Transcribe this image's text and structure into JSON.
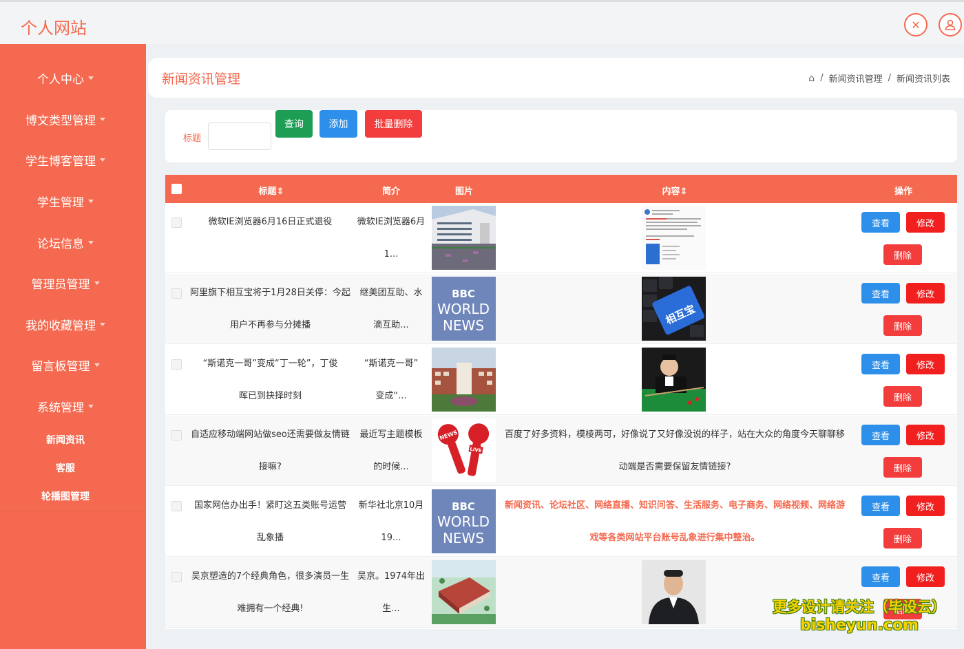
{
  "brand": "个人网站",
  "sidebar": {
    "menus": [
      {
        "label": "个人中心"
      },
      {
        "label": "博文类型管理"
      },
      {
        "label": "学生博客管理"
      },
      {
        "label": "学生管理"
      },
      {
        "label": "论坛信息"
      },
      {
        "label": "管理员管理"
      },
      {
        "label": "我的收藏管理"
      },
      {
        "label": "留言板管理"
      },
      {
        "label": "系统管理"
      }
    ],
    "submenus": [
      {
        "label": "新闻资讯"
      },
      {
        "label": "客服"
      },
      {
        "label": "轮播图管理"
      }
    ]
  },
  "header": {
    "title": "新闻资讯管理",
    "breadcrumb": [
      "新闻资讯管理",
      "新闻资讯列表"
    ]
  },
  "search": {
    "label": "标题",
    "query_button": "查询",
    "add_button": "添加",
    "batch_delete_button": "批量删除"
  },
  "table": {
    "headers": {
      "title": "标题⇕",
      "intro": "简介",
      "image": "图片",
      "content": "内容⇕",
      "actions": "操作"
    },
    "actions": {
      "view": "查看",
      "edit": "修改",
      "delete": "删除"
    },
    "rows": [
      {
        "title1": "微软IE浏览器6月16日正式退役",
        "title2": "",
        "intro1": "微软IE浏览器6月",
        "intro2": "1...",
        "image": "campus",
        "content_image": "document",
        "content1": "",
        "content2": ""
      },
      {
        "title1": "阿里旗下相互宝将于1月28日关停：今起",
        "title2": "用户不再参与分摊播",
        "intro1": "继美团互助、水",
        "intro2": "滴互助...",
        "image": "bbc",
        "content_image": "keyboard",
        "content1": "",
        "content2": ""
      },
      {
        "title1": "“斯诺克一哥”变成“丁一轮”，丁俊",
        "title2": "晖已到抉择时刻",
        "intro1": "“斯诺克一哥”",
        "intro2": "变成“...",
        "image": "building",
        "content_image": "snooker",
        "content1": "",
        "content2": ""
      },
      {
        "title1": "自适应移动端网站做seo还需要做友情链",
        "title2": "接嘛?",
        "intro1": "最近写主题模板",
        "intro2": "的时候...",
        "image": "mic",
        "content_image": "",
        "content1": "百度了好多资料，模棱两可，好像说了又好像没说的样子，站在大众的角度今天聊聊移",
        "content2": "动端是否需要保留友情链接?"
      },
      {
        "title1": "国家网信办出手！紧盯这五类账号运营",
        "title2": "乱象播",
        "intro1": "新华社北京10月",
        "intro2": "19...",
        "image": "bbc",
        "content_image": "",
        "content1": "新闻资讯、论坛社区、网络直播、知识问答、生活服务、电子商务、网络视频、网络游",
        "content2": "戏等各类网站平台账号乱象进行集中整治。"
      },
      {
        "title1": "吴京塑造的7个经典角色，很多演员一生",
        "title2": "难拥有一个经典!",
        "intro1": "吴京。1974年出",
        "intro2": "生...",
        "image": "aerial",
        "content_image": "portrait",
        "content1": "",
        "content2": ""
      }
    ]
  },
  "bbc_text": {
    "line1": "BBC",
    "line2": "WORLD",
    "line3": "NEWS"
  },
  "keyboard_text": "相互宝",
  "mic_text": {
    "news": "NEWS",
    "live": "LIVE"
  },
  "watermark": {
    "line1": "更多设计请关注（毕设云）",
    "line2": "bisheyun.com"
  },
  "colors": {
    "primary": "#f4694f",
    "view": "#2d8fe9",
    "edit": "#f21f1f",
    "query": "#1e9e55",
    "add": "#2d8fe9",
    "batch_delete": "#f33c3c"
  }
}
